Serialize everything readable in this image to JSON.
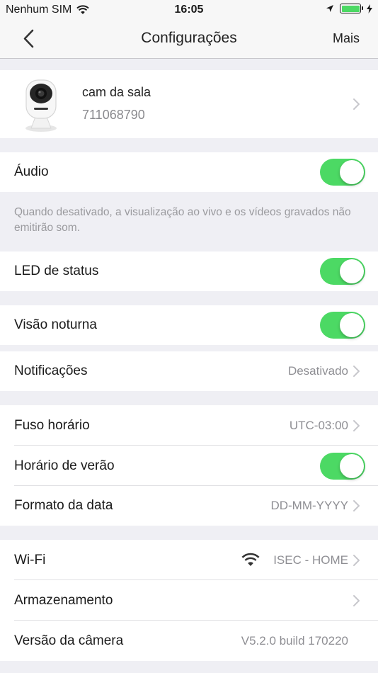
{
  "status_bar": {
    "carrier": "Nenhum SIM",
    "time": "16:05"
  },
  "nav": {
    "title": "Configurações",
    "more": "Mais"
  },
  "camera": {
    "name": "cam da sala",
    "id": "711068790",
    "brand_mark": "intelbras"
  },
  "settings": {
    "audio": {
      "label": "Áudio",
      "enabled": true
    },
    "audio_note": "Quando desativado, a visualização ao vivo e os vídeos gravados não emitirão som.",
    "status_led": {
      "label": "LED de status",
      "enabled": true
    },
    "night_vision": {
      "label": "Visão noturna",
      "enabled": true
    },
    "notifications": {
      "label": "Notificações",
      "value": "Desativado"
    },
    "timezone": {
      "label": "Fuso horário",
      "value": "UTC-03:00"
    },
    "dst": {
      "label": "Horário de verão",
      "enabled": true
    },
    "date_format": {
      "label": "Formato da data",
      "value": "DD-MM-YYYY"
    },
    "wifi": {
      "label": "Wi-Fi",
      "value": "ISEC - HOME"
    },
    "storage": {
      "label": "Armazenamento"
    },
    "camera_version": {
      "label": "Versão da câmera",
      "value": "V5.2.0 build 170220"
    }
  },
  "colors": {
    "toggle_on": "#4cd964",
    "background": "#efeff4",
    "secondary_text": "#8e8e93"
  }
}
